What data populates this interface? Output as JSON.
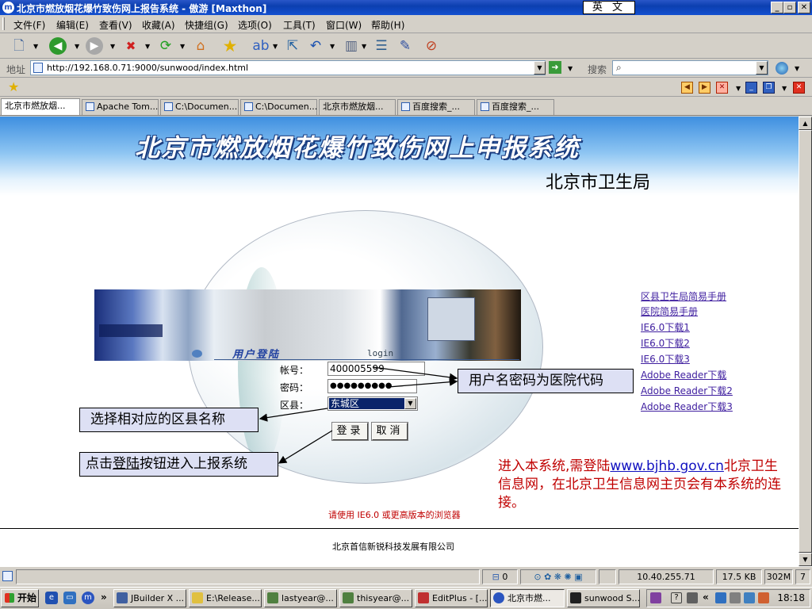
{
  "window": {
    "title": "北京市燃放烟花爆竹致伤网上报告系统 - 傲游 [Maxthon]",
    "app_icon": "maxthon-logo",
    "ime": "英 文",
    "controls": [
      "_",
      "▫",
      "✕"
    ]
  },
  "menu": [
    {
      "label": "文件(F)"
    },
    {
      "label": "编辑(E)"
    },
    {
      "label": "查看(V)"
    },
    {
      "label": "收藏(A)"
    },
    {
      "label": "快捷组(G)"
    },
    {
      "label": "选项(O)"
    },
    {
      "label": "工具(T)"
    },
    {
      "label": "窗口(W)"
    },
    {
      "label": "帮助(H)"
    }
  ],
  "toolbar": {
    "icons": [
      "new-page-icon",
      "back-icon",
      "forward-icon",
      "stop-icon",
      "refresh-icon",
      "home-icon",
      "favorites-star-icon",
      "translate-icon",
      "send-icon",
      "undo-icon",
      "columns-icon",
      "panel-icon",
      "edit-icon",
      "clear-icon"
    ]
  },
  "address": {
    "label": "地址",
    "url": "http://192.168.0.71:9000/sunwood/index.html",
    "search_label": "搜索",
    "search_value": ""
  },
  "tabs": [
    {
      "label": "北京市燃放烟..."
    },
    {
      "label": "Apache Tom..."
    },
    {
      "label": "C:\\Documen..."
    },
    {
      "label": "C:\\Documen..."
    },
    {
      "label": "北京市燃放烟..."
    },
    {
      "label": "百度搜索_..."
    },
    {
      "label": "百度搜索_..."
    }
  ],
  "page": {
    "system_title": "北京市燃放烟花爆竹致伤网上申报系统",
    "bureau": "北京市卫生局",
    "login_title": "用户登陆",
    "login_tag": "login",
    "form": {
      "account_label": "帐号：",
      "account_value": "400005599",
      "password_label": "密码：",
      "password_value": "●●●●●●●●●",
      "district_label": "区县：",
      "district_value": "东城区",
      "login_button": "登录",
      "cancel_button": "取消"
    },
    "browser_note": "请使用  IE6.0 或更高版本的浏览器",
    "company": "北京首信新锐科技发展有限公司",
    "side_links": [
      "区县卫生局简易手册",
      "医院简易手册",
      "IE6.0下载1",
      "IE6.0下载2",
      "IE6.0下载3",
      "Adobe Reader下载",
      "Adobe Reader下载2",
      "Adobe Reader下载3"
    ],
    "callouts": {
      "user_pass": "用户名密码为医院代码",
      "district": "选择相对应的区县名称",
      "login_pre": "点击",
      "login_underline": "登陆",
      "login_post": "按钮进入上报系统"
    },
    "red_info": {
      "pre": "进入本系统,需登陆",
      "url": "www.bjhb.gov.cn",
      "post": "北京卫生信息网，在北京卫生信息网主页会有本系统的连接。"
    }
  },
  "status": {
    "count": "0",
    "ip": "10.40.255.71",
    "size": "17.5 KB",
    "memory": "302M",
    "extra": "7"
  },
  "taskbar": {
    "start": "开始",
    "tasks": [
      {
        "label": "JBuilder X ..."
      },
      {
        "label": "E:\\Release..."
      },
      {
        "label": "lastyear@..."
      },
      {
        "label": "thisyear@..."
      },
      {
        "label": "EditPlus - [..."
      },
      {
        "label": "北京市燃..."
      },
      {
        "label": "sunwood S..."
      }
    ],
    "clock": "18:18"
  }
}
